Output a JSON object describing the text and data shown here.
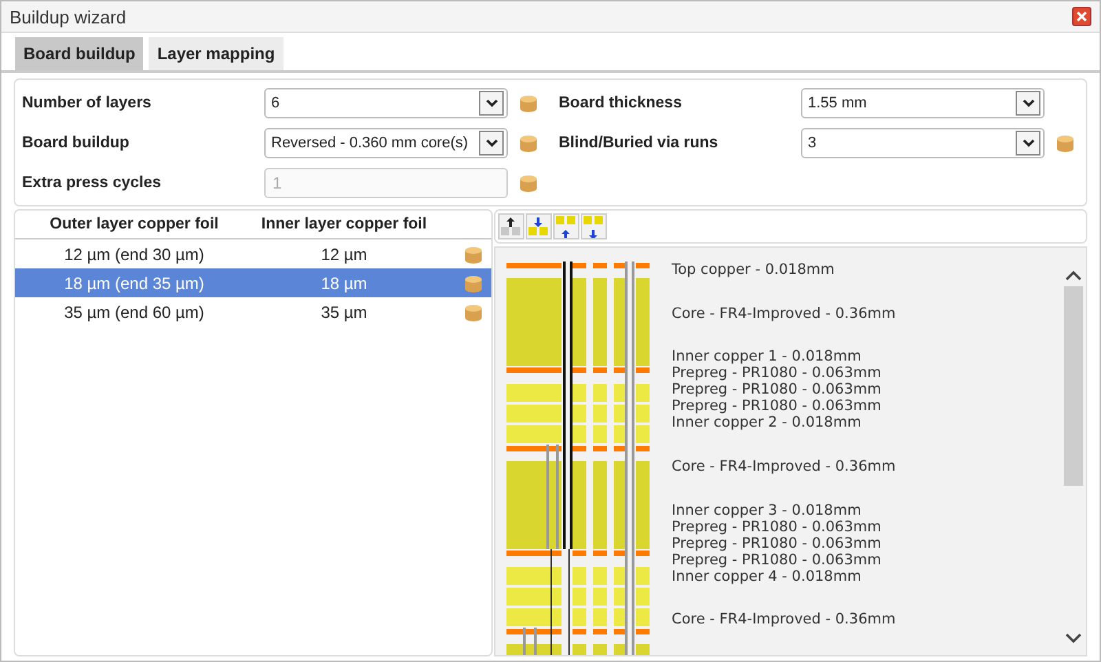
{
  "window": {
    "title": "Buildup wizard"
  },
  "tabs": [
    {
      "label": "Board buildup",
      "selected": true
    },
    {
      "label": "Layer mapping",
      "selected": false
    }
  ],
  "settings": {
    "left": [
      {
        "label": "Number of layers",
        "kind": "select",
        "value": "6",
        "info_icon": true
      },
      {
        "label": "Board buildup",
        "kind": "select",
        "value": "Reversed - 0.360 mm core(s)",
        "info_icon": true
      },
      {
        "label": "Extra press cycles",
        "kind": "input",
        "value": "1",
        "disabled": true,
        "info_icon": true
      }
    ],
    "right": [
      {
        "label": "Board thickness",
        "kind": "select",
        "value": "1.55 mm",
        "info_icon": false
      },
      {
        "label": "Blind/Buried via runs",
        "kind": "select",
        "value": "3",
        "info_icon": true
      }
    ]
  },
  "copper_table": {
    "columns": [
      "Outer layer copper foil",
      "Inner layer copper foil"
    ],
    "rows": [
      {
        "outer": "12 µm (end 30 µm)",
        "inner": "12 µm",
        "selected": false
      },
      {
        "outer": "18 µm (end 35 µm)",
        "inner": "18 µm",
        "selected": true
      },
      {
        "outer": "35 µm (end 60 µm)",
        "inner": "35 µm",
        "selected": false
      }
    ]
  },
  "toolbar": [
    {
      "kind": "topup",
      "disabled": true
    },
    {
      "kind": "topdown",
      "disabled": false
    },
    {
      "kind": "bottomup",
      "disabled": false
    },
    {
      "kind": "bottomdown",
      "disabled": false
    }
  ],
  "stackup": [
    {
      "kind": "copper",
      "label": "Top copper - 0.018mm"
    },
    {
      "kind": "core",
      "label": "Core - FR4-Improved - 0.36mm"
    },
    {
      "kind": "copper",
      "label": "Inner copper 1 - 0.018mm"
    },
    {
      "kind": "prepreg",
      "label": "Prepreg - PR1080 - 0.063mm"
    },
    {
      "kind": "prepreg",
      "label": "Prepreg - PR1080 - 0.063mm"
    },
    {
      "kind": "prepreg",
      "label": "Prepreg - PR1080 - 0.063mm"
    },
    {
      "kind": "copper",
      "label": "Inner copper 2 - 0.018mm"
    },
    {
      "kind": "core",
      "label": "Core - FR4-Improved - 0.36mm"
    },
    {
      "kind": "copper",
      "label": "Inner copper 3 - 0.018mm"
    },
    {
      "kind": "prepreg",
      "label": "Prepreg - PR1080 - 0.063mm"
    },
    {
      "kind": "prepreg",
      "label": "Prepreg - PR1080 - 0.063mm"
    },
    {
      "kind": "prepreg",
      "label": "Prepreg - PR1080 - 0.063mm"
    },
    {
      "kind": "copper",
      "label": "Inner copper 4 - 0.018mm"
    },
    {
      "kind": "core",
      "label": "Core - FR4-Improved - 0.36mm"
    }
  ]
}
